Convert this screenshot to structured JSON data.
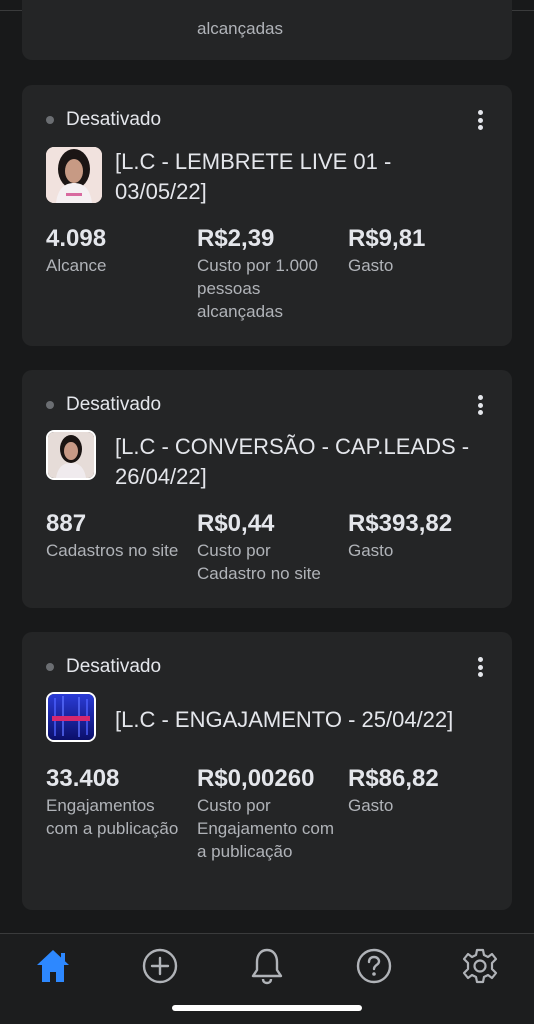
{
  "partial_card": {
    "label": "alcançadas"
  },
  "campaigns": [
    {
      "status": "Desativado",
      "title": "[L.C - LEMBRETE LIVE 01 - 03/05/22]",
      "metrics": [
        {
          "value": "4.098",
          "label": "Alcance"
        },
        {
          "value": "R$2,39",
          "label": "Custo por 1.000 pessoas alcançadas"
        },
        {
          "value": "R$9,81",
          "label": "Gasto"
        }
      ]
    },
    {
      "status": "Desativado",
      "title": "[L.C - CONVERSÃO - CAP.LEADS  - 26/04/22]",
      "metrics": [
        {
          "value": "887",
          "label": "Cadastros no site"
        },
        {
          "value": "R$0,44",
          "label": "Custo por Cadastro no site"
        },
        {
          "value": "R$393,82",
          "label": "Gasto"
        }
      ]
    },
    {
      "status": "Desativado",
      "title": "[L.C - ENGAJAMENTO - 25/04/22]",
      "metrics": [
        {
          "value": "33.408",
          "label": "Engajamentos com a publicação"
        },
        {
          "value": "R$0,00260",
          "label": "Custo por Engajamento com a publicação"
        },
        {
          "value": "R$86,82",
          "label": "Gasto"
        }
      ]
    }
  ],
  "tab_bar": {
    "active_color": "#2d88ff",
    "inactive_color": "#b0b3b8",
    "tabs": [
      {
        "icon": "home-icon",
        "active": true
      },
      {
        "icon": "add-circle-icon",
        "active": false
      },
      {
        "icon": "bell-icon",
        "active": false
      },
      {
        "icon": "help-icon",
        "active": false
      },
      {
        "icon": "settings-gear-icon",
        "active": false
      }
    ]
  }
}
